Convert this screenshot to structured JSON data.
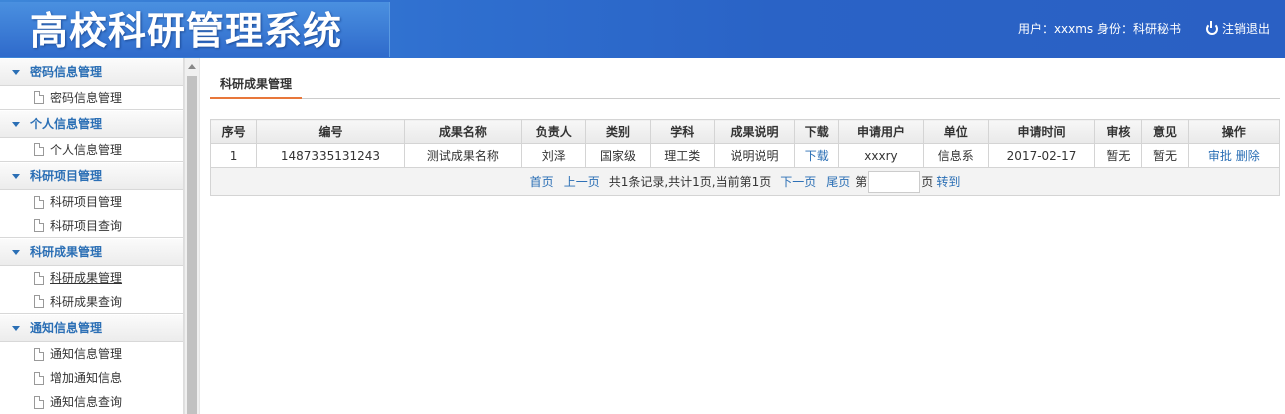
{
  "header": {
    "title": "高校科研管理系统",
    "user_info": "用户：xxxms 身份：科研秘书",
    "logout_label": "注销退出"
  },
  "sidebar": {
    "groups": [
      {
        "title": "密码信息管理",
        "items": [
          "密码信息管理"
        ]
      },
      {
        "title": "个人信息管理",
        "items": [
          "个人信息管理"
        ]
      },
      {
        "title": "科研项目管理",
        "items": [
          "科研项目管理",
          "科研项目查询"
        ]
      },
      {
        "title": "科研成果管理",
        "items": [
          "科研成果管理",
          "科研成果查询"
        ]
      },
      {
        "title": "通知信息管理",
        "items": [
          "通知信息管理",
          "增加通知信息",
          "通知信息查询"
        ]
      }
    ]
  },
  "main": {
    "tab_label": "科研成果管理",
    "table": {
      "columns": [
        "序号",
        "编号",
        "成果名称",
        "负责人",
        "类别",
        "学科",
        "成果说明",
        "下载",
        "申请用户",
        "单位",
        "申请时间",
        "审核",
        "意见",
        "操作"
      ],
      "rows": [
        {
          "index": "1",
          "code": "1487335131243",
          "name": "测试成果名称",
          "leader": "刘泽",
          "category": "国家级",
          "subject": "理工类",
          "description": "说明说明",
          "download": "下载",
          "user": "xxxry",
          "unit": "信息系",
          "time": "2017-02-17",
          "review": "暂无",
          "opinion": "暂无",
          "op_approve": "审批",
          "op_delete": "删除"
        }
      ]
    },
    "pager": {
      "first": "首页",
      "prev": "上一页",
      "summary": "共1条记录,共计1页,当前第1页",
      "next": "下一页",
      "last": "尾页",
      "page_prefix": "第",
      "page_suffix": "页",
      "goto": "转到",
      "page_input_value": ""
    }
  },
  "colors": {
    "header_blue": "#2f6fcf",
    "link_blue": "#2b6fb5",
    "tab_accent": "#e8773a"
  }
}
